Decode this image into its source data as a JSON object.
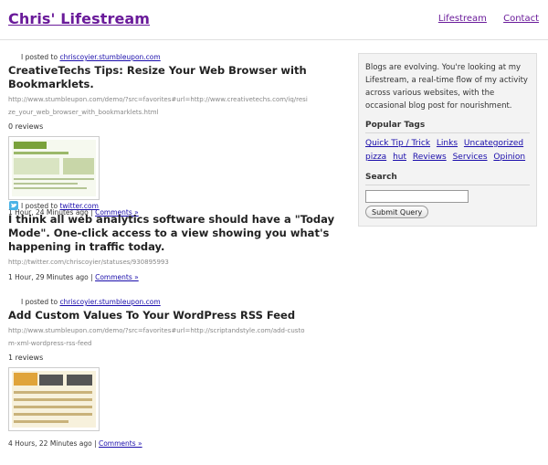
{
  "header": {
    "site_title": "Chris' Lifestream",
    "nav": [
      "Lifestream",
      "Contact"
    ]
  },
  "entries": [
    {
      "posted_prefix": "I posted to",
      "source": "chriscoyier.stumbleupon.com",
      "title": "CreativeTechs Tips: Resize Your Web Browser with Bookmarklets.",
      "url": "http://www.stumbleupon.com/demo/?src=favorites#url=http://www.creativetechs.com/iq/resize_your_web_browser_with_bookmarklets.html",
      "reviews": "0 reviews",
      "time": "1 Hour, 24 Minutes ago",
      "comments_label": "Comments »"
    },
    {
      "posted_prefix": "I posted to",
      "source": "twitter.com",
      "title": "I think all web analytics software should have a \"Today Mode\". One-click access to a view showing you what's happening in traffic today.",
      "url": "http://twitter.com/chriscoyier/statuses/930895993",
      "time": "1 Hour, 29 Minutes ago",
      "comments_label": "Comments »"
    },
    {
      "posted_prefix": "I posted to",
      "source": "chriscoyier.stumbleupon.com",
      "title": "Add Custom Values To Your WordPress RSS Feed",
      "url": "http://www.stumbleupon.com/demo/?src=favorites#url=http://scriptandstyle.com/add-custom-xml-wordpress-rss-feed",
      "reviews": "1 reviews",
      "time": "4 Hours, 22 Minutes ago",
      "comments_label": "Comments »"
    }
  ],
  "sidebar": {
    "intro": "Blogs are evolving. You're looking at my Lifestream, a real-time flow of my activity across various websites, with the occasional blog post for nourishment.",
    "tags_heading": "Popular Tags",
    "tags": [
      "Quick Tip / Trick",
      "Links",
      "Uncategorized",
      "pizza",
      "hut",
      "Reviews",
      "Services",
      "Opinion"
    ],
    "search_heading": "Search",
    "search_button": "Submit Query"
  },
  "colors": {
    "title_purple": "#6a1b9a",
    "link_blue": "#1a0dab",
    "sidebar_bg": "#f3f3f3"
  },
  "icons": {
    "twitter": "twitter-bird-icon"
  }
}
